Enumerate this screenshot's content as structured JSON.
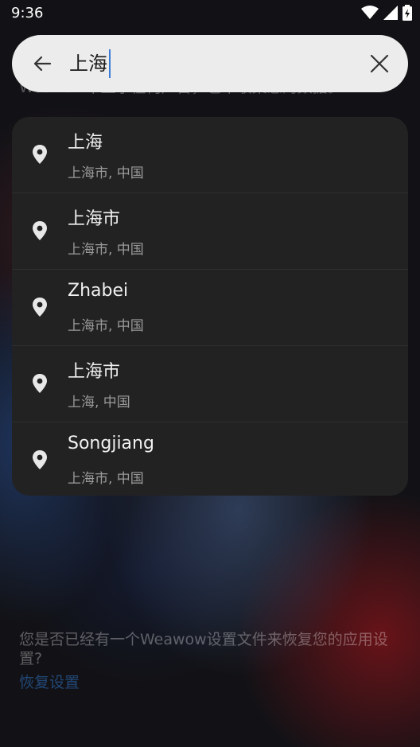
{
  "status_bar": {
    "time": "9:36"
  },
  "background": {
    "top_text": "Weawow不显示任何广告，也不收集您的数据。",
    "bottom_text": "您是否已经有一个Weawow设置文件来恢复您的应用设置?",
    "restore_link": "恢复设置"
  },
  "search": {
    "value": "上海"
  },
  "results": [
    {
      "title": "上海",
      "subtitle": "上海市, 中国"
    },
    {
      "title": "上海市",
      "subtitle": "上海市, 中国"
    },
    {
      "title": "Zhabei",
      "subtitle": "上海市, 中国"
    },
    {
      "title": "上海市",
      "subtitle": "上海, 中国"
    },
    {
      "title": "Songjiang",
      "subtitle": "上海市, 中国"
    }
  ],
  "colors": {
    "search_bg": "#ececec",
    "dropdown_bg": "#222222",
    "caret": "#3a7bd5"
  }
}
